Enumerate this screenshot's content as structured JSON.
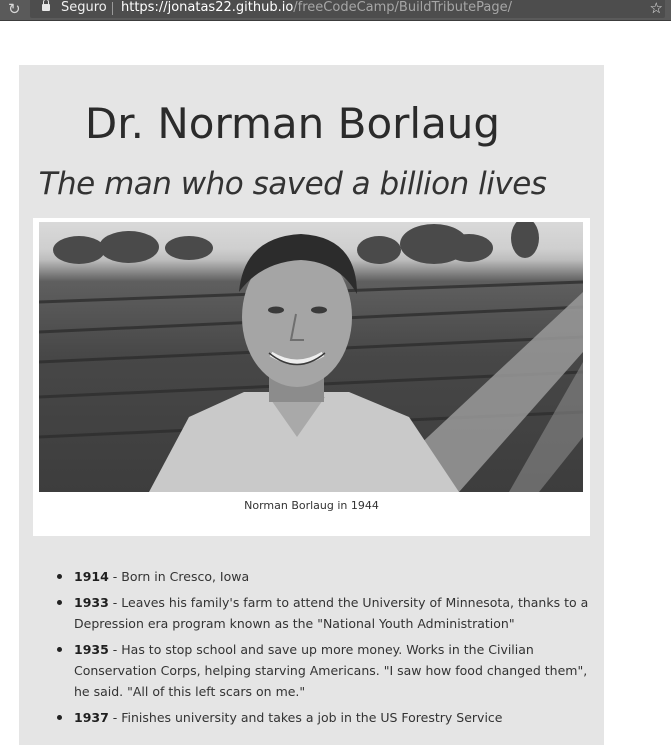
{
  "browser": {
    "secure_label": "Seguro",
    "url_host": "https://jonatas22.github.io",
    "url_path": "/freeCodeCamp/BuildTributePage/",
    "icons": [
      "reload-icon",
      "lock-icon",
      "star-icon"
    ]
  },
  "tribute": {
    "title": "Dr. Norman Borlaug",
    "subtitle": "The man who saved a billion lives",
    "image_caption": "Norman Borlaug in 1944",
    "timeline": [
      {
        "year": "1914",
        "text": " - Born in Cresco, Iowa"
      },
      {
        "year": "1933",
        "text": " - Leaves his family's farm to attend the University of Minnesota, thanks to a Depression era program known as the \"National Youth Administration\""
      },
      {
        "year": "1935",
        "text": " - Has to stop school and save up more money. Works in the Civilian Conservation Corps, helping starving Americans. \"I saw how food changed them\", he said. \"All of this left scars on me.\""
      },
      {
        "year": "1937",
        "text": " - Finishes university and takes a job in the US Forestry Service"
      }
    ]
  },
  "colors": {
    "chrome": "#5a5a5a",
    "panel": "#e5e5e5",
    "text": "#333333"
  }
}
